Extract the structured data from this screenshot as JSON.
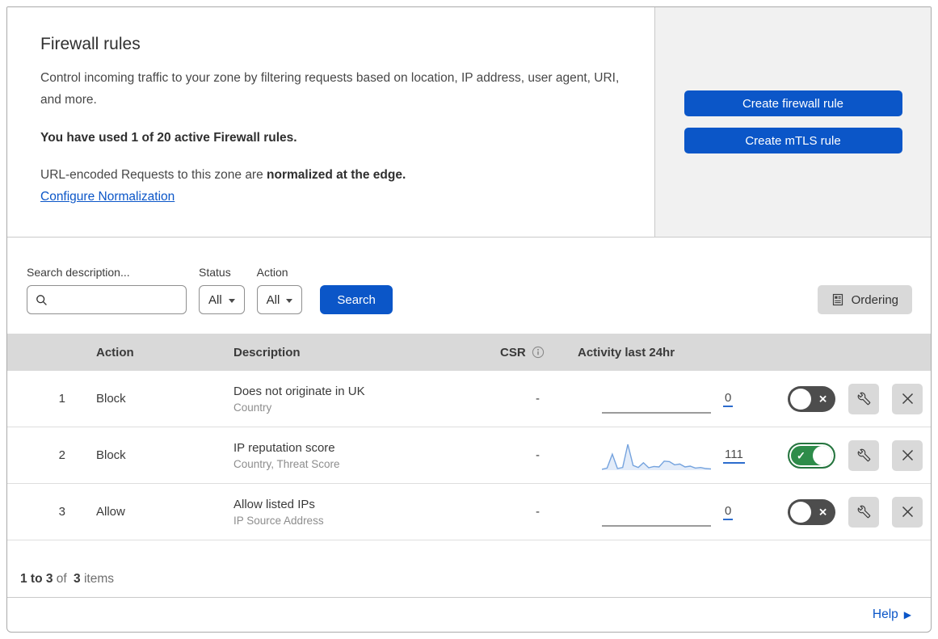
{
  "header": {
    "title": "Firewall rules",
    "description": "Control incoming traffic to your zone by filtering requests based on location, IP address, user agent, URI, and more.",
    "usage_notice": "You have used 1 of 20 active Firewall rules.",
    "normalization_prefix": "URL-encoded Requests to this zone are ",
    "normalization_bold": "normalized at the edge.",
    "normalization_link": "Configure Normalization",
    "create_firewall_rule_label": "Create firewall rule",
    "create_mtls_rule_label": "Create mTLS rule"
  },
  "filters": {
    "search_label": "Search description...",
    "status_label": "Status",
    "status_value": "All",
    "action_label": "Action",
    "action_value": "All",
    "search_button_label": "Search",
    "ordering_button_label": "Ordering"
  },
  "table": {
    "columns": {
      "action": "Action",
      "description": "Description",
      "csr": "CSR",
      "activity": "Activity last 24hr"
    },
    "rows": [
      {
        "priority": "1",
        "action": "Block",
        "description": "Does not originate in UK",
        "fields": "Country",
        "csr": "-",
        "activity_count": "0",
        "enabled": false,
        "has_sparkline": false
      },
      {
        "priority": "2",
        "action": "Block",
        "description": "IP reputation score",
        "fields": "Country, Threat Score",
        "csr": "-",
        "activity_count": "111",
        "enabled": true,
        "has_sparkline": true
      },
      {
        "priority": "3",
        "action": "Allow",
        "description": "Allow listed IPs",
        "fields": "IP Source Address",
        "csr": "-",
        "activity_count": "0",
        "enabled": false,
        "has_sparkline": false
      }
    ]
  },
  "chart_data": {
    "type": "line",
    "title": "Activity last 24hr sparkline (rule 2)",
    "total_requests": 111,
    "values": [
      3,
      8,
      60,
      6,
      10,
      97,
      18,
      10,
      28,
      9,
      14,
      12,
      34,
      32,
      20,
      23,
      12,
      15,
      8,
      10,
      6,
      5
    ],
    "ylim": [
      0,
      100
    ],
    "line_color": "#75a3de",
    "fill_color": "#e3ecf9",
    "grid": false,
    "axes_hidden": true
  },
  "footer": {
    "range": "1 to 3",
    "of_text": "of",
    "total": "3",
    "items_text": "items",
    "help_label": "Help"
  },
  "icons": {
    "check_icon": "✓",
    "x_icon": "✕",
    "help_arrow_icon": "▶"
  },
  "colors": {
    "accent_blue": "#0b56c8",
    "toggle_on_green": "#2e8c4a",
    "toggle_off_gray": "#4d4d4d",
    "table_header_gray": "#d9d9d9",
    "side_panel_gray": "#f1f1f1",
    "sparkline_blue": "#75a3de"
  }
}
